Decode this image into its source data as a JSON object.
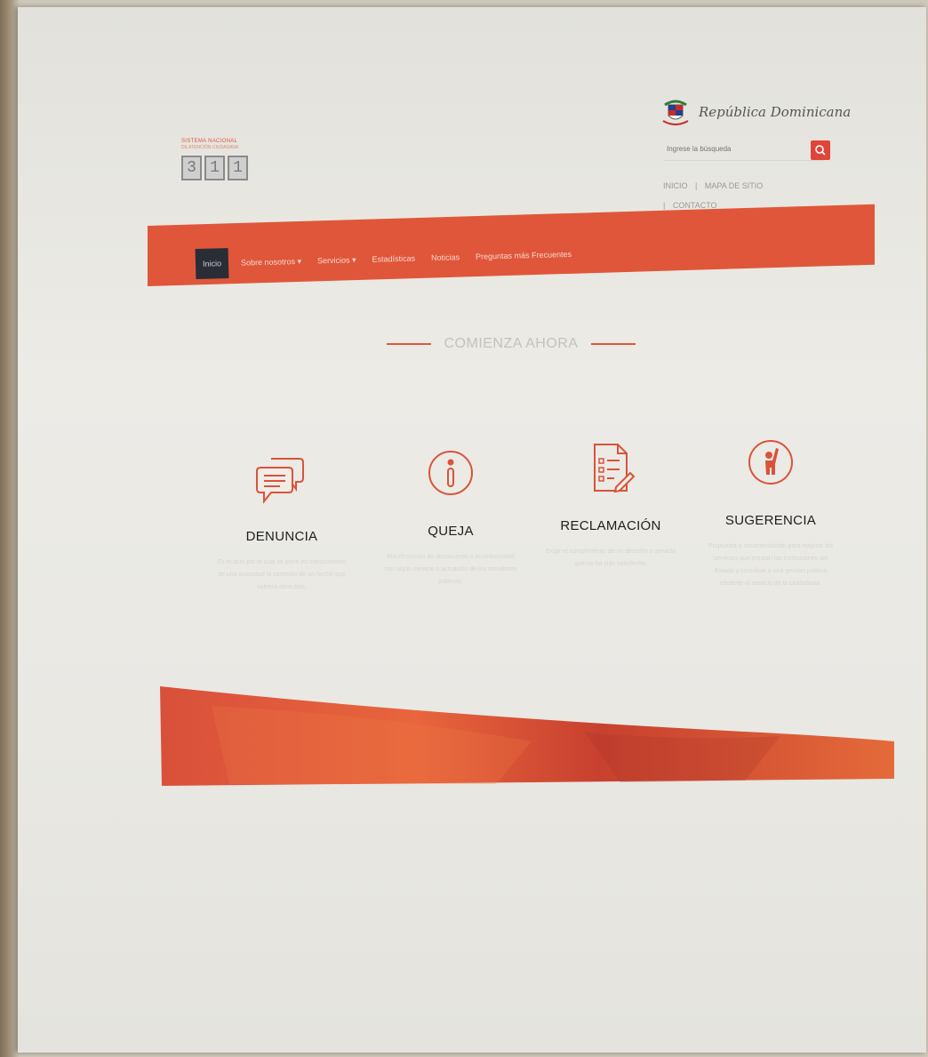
{
  "header": {
    "logo": {
      "line1": "SISTEMA NACIONAL",
      "line2": "DE ATENCIÓN CIUDADANA",
      "digits": [
        "3",
        "1",
        "1"
      ]
    },
    "gov_name": "República Dominicana",
    "search": {
      "placeholder": "Ingrese la búsqueda"
    },
    "top_links": [
      "INICIO",
      "|",
      "MAPA DE SITIO",
      "|",
      "CONTACTO"
    ]
  },
  "nav": {
    "items": [
      {
        "label": "Inicio",
        "active": true
      },
      {
        "label": "Sobre nosotros ▾"
      },
      {
        "label": "Servicios ▾"
      },
      {
        "label": "Estadísticas"
      },
      {
        "label": "Noticias"
      },
      {
        "label": "Preguntas más Frecuentes"
      }
    ]
  },
  "section": {
    "title": "COMIENZA AHORA"
  },
  "cards": [
    {
      "icon": "speech-bubbles-icon",
      "title": "DENUNCIA",
      "text": "Es el acto por el cual se pone en conocimiento de una autoridad la comisión de un hecho que vulnera derechos."
    },
    {
      "icon": "info-circle-icon",
      "title": "QUEJA",
      "text": "Manifestación de desacuerdo o inconformidad con algún servicio o actuación de los servidores públicos."
    },
    {
      "icon": "document-checklist-icon",
      "title": "RECLAMACIÓN",
      "text": "Exigir el cumplimiento de un derecho o servicio que no ha sido satisfecho."
    },
    {
      "icon": "person-raising-hand-icon",
      "title": "SUGERENCIA",
      "text": "Propuesta o recomendación para mejorar los servicios que prestan las instituciones del Estado y contribuir a una gestión pública eficiente al servicio de la ciudadanía."
    }
  ],
  "colors": {
    "accent": "#e0563a",
    "nav_active": "#2a2d36"
  }
}
